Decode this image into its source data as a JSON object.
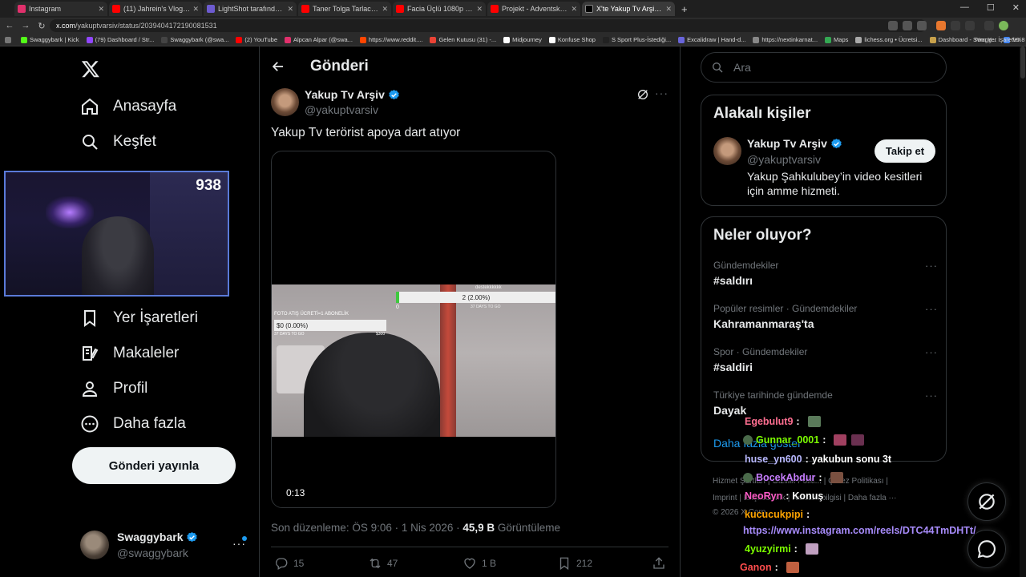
{
  "browser": {
    "tabs": [
      {
        "label": "Instagram",
        "color": "#e1306c",
        "active": false
      },
      {
        "label": "(11) Jahrein's Vlog (Berlin'de İş",
        "color": "#ff0000",
        "active": false
      },
      {
        "label": "LightShot tarafından Ekran Gör",
        "color": "#6d5bd0",
        "active": false
      },
      {
        "label": "Taner Tolga Tarlacı Kaç Sene Ce",
        "color": "#ff0000",
        "active": false
      },
      {
        "label": "Facia Üçlü 1080p Full İzle | Yerli",
        "color": "#ff0000",
        "active": false
      },
      {
        "label": "Projekt - Adventskalender | Tür",
        "color": "#ff0000",
        "active": false
      },
      {
        "label": "X'te Yakup Tv Arşiv: \"Yakup Tv t",
        "color": "#000000",
        "active": true
      }
    ],
    "url_host": "x.com",
    "url_path": "/yakuptvarsiv/status/2039404172190081531",
    "bookmarks": [
      {
        "label": "Swaggybark | Kick",
        "color": "#53fc18"
      },
      {
        "label": "(79) Dashboard / Str...",
        "color": "#9146ff"
      },
      {
        "label": "Swaggybark (@swa...",
        "color": "#444444"
      },
      {
        "label": "(2) YouTube",
        "color": "#ff0000"
      },
      {
        "label": "Alpcan Alpar (@swa...",
        "color": "#e1306c"
      },
      {
        "label": "https://www.reddit....",
        "color": "#ff4500"
      },
      {
        "label": "Gelen Kutusu (31) -...",
        "color": "#ea4335"
      },
      {
        "label": "Midjourney",
        "color": "#ffffff"
      },
      {
        "label": "Konfuse Shop",
        "color": "#ffffff"
      },
      {
        "label": "S Sport Plus-İstediği...",
        "color": "#222222"
      },
      {
        "label": "Excalidraw | Hand-d...",
        "color": "#6965db"
      },
      {
        "label": "https://nextinkarnat...",
        "color": "#888888"
      },
      {
        "label": "Maps",
        "color": "#34a853"
      },
      {
        "label": "lichess.org • Ücretsi...",
        "color": "#aaaaaa"
      },
      {
        "label": "Dashboard - Swagg...",
        "color": "#c8a14b"
      },
      {
        "label": "V0.8 – Google Dokü...",
        "color": "#4285f4"
      }
    ],
    "all_bookmarks": "Tüm Yer İşaretleri"
  },
  "nav": {
    "items": [
      {
        "label": "Anasayfa",
        "icon": "home-icon"
      },
      {
        "label": "Keşfet",
        "icon": "search-icon"
      },
      {
        "label": "Yer İşaretleri",
        "icon": "bookmark-icon"
      },
      {
        "label": "Makaleler",
        "icon": "article-icon"
      },
      {
        "label": "Profil",
        "icon": "profile-icon"
      },
      {
        "label": "Daha fazla",
        "icon": "more-icon"
      }
    ],
    "post_button": "Gönderi yayınla",
    "account": {
      "name": "Swaggybark",
      "handle": "@swaggybark"
    }
  },
  "webcam": {
    "viewer_count": "938"
  },
  "post": {
    "header_title": "Gönderi",
    "author_name": "Yakup Tv Arşiv",
    "author_handle": "@yakuptvarsiv",
    "text": "Yakup Tv terörist apoya dart atıyor",
    "video": {
      "timestamp": "0:13",
      "goal1_label": "destekkkkkk",
      "goal1_value": "2 (2.00%)",
      "goal1_progress": 0.02,
      "goal1_sub": "37 DAYS TO GO",
      "goal1_zero": "0",
      "goal2_label": "FOTO ATIŞ ÜCRETİ=1 ABONELİK",
      "goal2_value": "$0 (0.00%)",
      "goal2_progress": 0.0,
      "goal2_sub": "37 DAYS TO GO",
      "goal2_max": "$300"
    },
    "edited": "Son düzenleme: ÖS 9:06 · 1 Nis 2026 · ",
    "views": "45,9 B",
    "views_label": " Görüntüleme",
    "actions": {
      "replies": "15",
      "reposts": "47",
      "likes": "1 B",
      "bookmarks": "212"
    }
  },
  "sidebar": {
    "search_placeholder": "Ara",
    "related_title": "Alakalı kişiler",
    "related": {
      "name": "Yakup Tv Arşiv",
      "handle": "@yakuptvarsiv",
      "bio": "Yakup Şahkulubey’in video kesitleri için amme hizmeti.",
      "follow": "Takip et"
    },
    "trends_title": "Neler oluyor?",
    "trends": [
      {
        "context": "Gündemdekiler",
        "name": "#saldırı"
      },
      {
        "context": "Popüler resimler · Gündemdekiler",
        "name": "Kahramanmaraş'ta"
      },
      {
        "context": "Spor · Gündemdekiler",
        "name": "#saldiri"
      },
      {
        "context": "Türkiye tarihinde gündemde",
        "name": "Dayak"
      }
    ],
    "show_more": "Daha fazla göster",
    "footer": {
      "l1": "Hizmet Şartları | Gizlilik Politi... | Çerez Politikası |",
      "l2": "Imprint | Erişilebilirlik | Reklam bilgisi | Daha fazla ···",
      "l3": "© 2026 X Corp."
    }
  },
  "chat": [
    {
      "user": "Egebulut9",
      "color": "#ff6f91",
      "msg": "",
      "badge": false
    },
    {
      "user": "Gunnar_0001",
      "color": "#7cfc00",
      "msg": "",
      "badge": true
    },
    {
      "user": "huse_yn600",
      "color": "#b9b9ff",
      "msg": "yakubun sonu 3t",
      "badge": false
    },
    {
      "user": "BocekAbdur",
      "color": "#c77dff",
      "msg": "",
      "badge": true
    },
    {
      "user": "NeoRyn",
      "color": "#ff5cc8",
      "msg": "Konuş",
      "badge": false
    },
    {
      "user": "kucucukpipi",
      "color": "#ffa500",
      "msg": "",
      "badge": false
    },
    {
      "user": "",
      "color": "#a78bfa",
      "msg": "https://www.instagram.com/reels/DTC44TmDHTt/",
      "badge": false
    },
    {
      "user": "4yuzyirmi",
      "color": "#7cfc00",
      "msg": "",
      "badge": false
    },
    {
      "user": "Ganon",
      "color": "#ff4d4d",
      "msg": "",
      "badge": false
    }
  ],
  "colors": {
    "accent": "#1d9bf0",
    "border": "#2f3336",
    "muted": "#71767b"
  }
}
